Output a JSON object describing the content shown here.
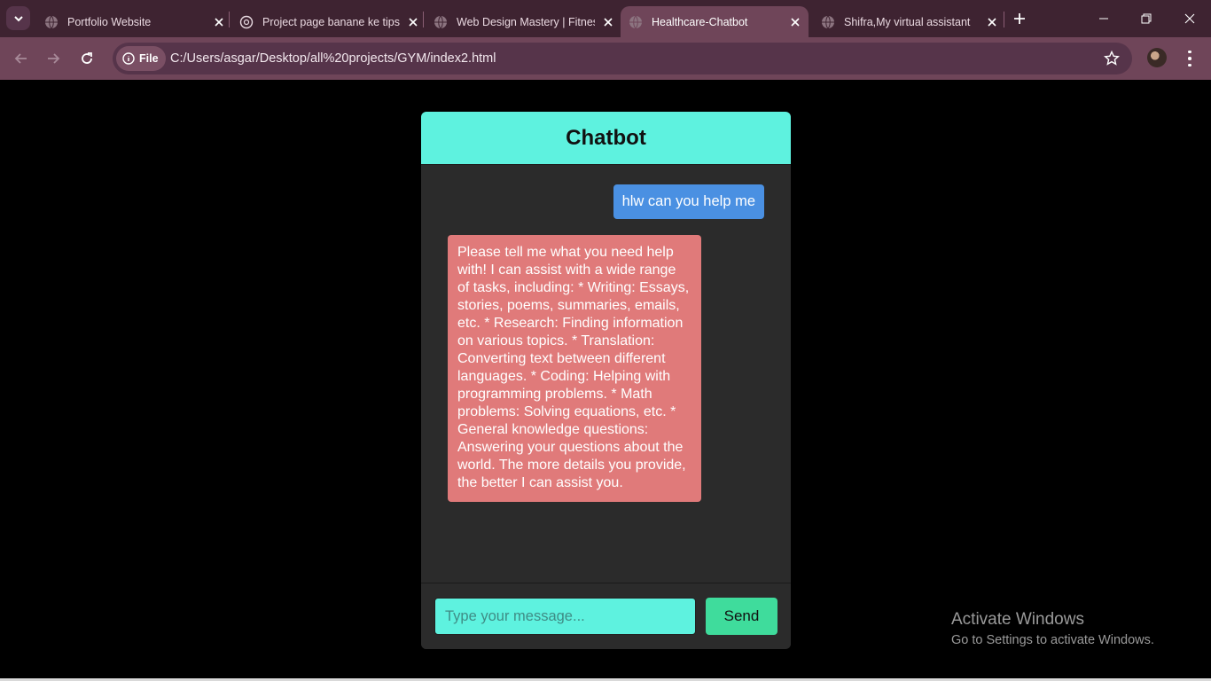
{
  "browser": {
    "tabs": [
      {
        "title": "Portfolio Website",
        "icon": "globe-icon",
        "active": false
      },
      {
        "title": "Project page banane ke tips",
        "icon": "openai-icon",
        "active": false
      },
      {
        "title": "Web Design Mastery | Fitness",
        "icon": "globe-icon",
        "active": false
      },
      {
        "title": "Healthcare-Chatbot",
        "icon": "globe-icon",
        "active": true
      },
      {
        "title": "Shifra,My virtual assistant",
        "icon": "globe-icon",
        "active": false
      }
    ],
    "site_chip_label": "File",
    "url": "C:/Users/asgar/Desktop/all%20projects/GYM/index2.html"
  },
  "chat": {
    "title": "Chatbot",
    "messages": [
      {
        "role": "user",
        "text": "hlw can you help me"
      },
      {
        "role": "bot",
        "text": "Please tell me what you need help with! I can assist with a wide range of tasks, including: * Writing: Essays, stories, poems, summaries, emails, etc. * Research: Finding information on various topics. * Translation: Converting text between different languages. * Coding: Helping with programming problems. * Math problems: Solving equations, etc. * General knowledge questions: Answering your questions about the world. The more details you provide, the better I can assist you."
      }
    ],
    "input_placeholder": "Type your message...",
    "send_label": "Send"
  },
  "watermark": {
    "line1": "Activate Windows",
    "line2": "Go to Settings to activate Windows."
  },
  "colors": {
    "header_bg": "#5ef2df",
    "user_bubble": "#4a90e2",
    "bot_bubble": "#e07a7a",
    "send_button": "#3fdc9c"
  }
}
